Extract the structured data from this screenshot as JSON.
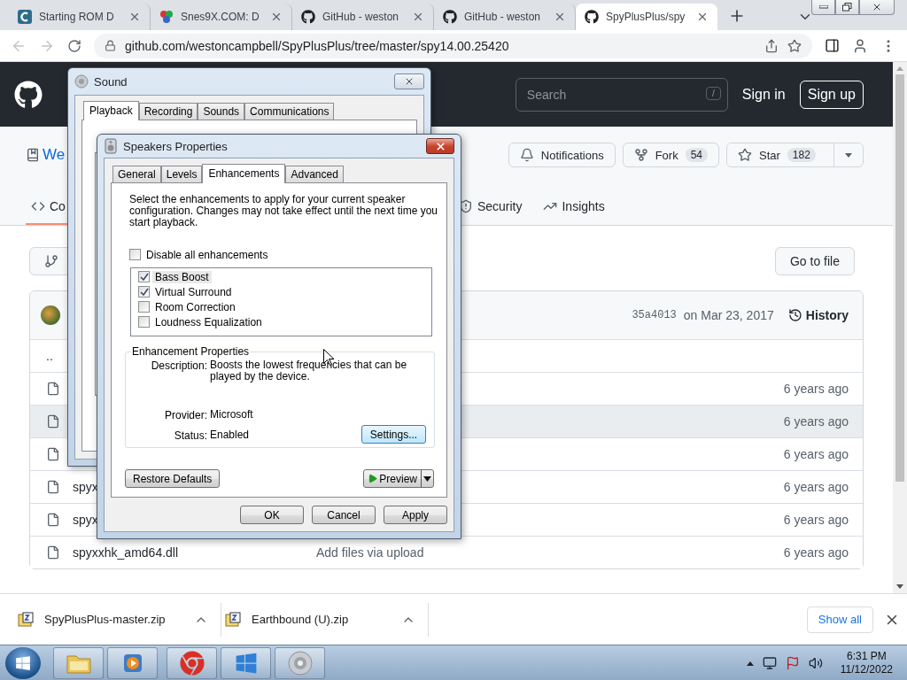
{
  "browser": {
    "tabs": [
      {
        "kind": "letter",
        "title": "Starting ROM D",
        "selected": false
      },
      {
        "kind": "balls",
        "title": "Snes9X.COM: D",
        "selected": false
      },
      {
        "kind": "octocat",
        "title": "GitHub - weston",
        "selected": false
      },
      {
        "kind": "octocat",
        "title": "GitHub - weston",
        "selected": false
      },
      {
        "kind": "octocat",
        "title": "SpyPlusPlus/spy",
        "selected": true
      }
    ],
    "address": "github.com/westoncampbell/SpyPlusPlus/tree/master/spy14.00.25420"
  },
  "github": {
    "search": {
      "placeholder": "Search",
      "shortcut": "/"
    },
    "sign_in": "Sign in",
    "sign_up": "Sign up",
    "repo_name": "We",
    "notifications": "Notifications",
    "fork": {
      "label": "Fork",
      "count": "54"
    },
    "star": {
      "label": "Star",
      "count": "182"
    },
    "repo_tabs": [
      {
        "kind": "code",
        "label": "Co",
        "selected": true
      },
      {
        "kind": "security",
        "label": "Security",
        "selected": false
      },
      {
        "kind": "insights",
        "label": "Insights",
        "selected": false
      }
    ],
    "go_to_file": "Go to file",
    "commit": {
      "hash": "35a4013",
      "date": "on Mar 23, 2017",
      "history": "History"
    },
    "files": [
      {
        "kind": "parent",
        "name": "..",
        "hovered": false
      },
      {
        "kind": "file",
        "age": "6 years ago",
        "hovered": false
      },
      {
        "kind": "file",
        "age": "6 years ago",
        "hovered": true
      },
      {
        "kind": "file",
        "age": "6 years ago",
        "hovered": false
      },
      {
        "kind": "file",
        "name": "spyx",
        "age": "6 years ago",
        "hovered": false
      },
      {
        "kind": "file",
        "name": "spyx",
        "age": "6 years ago",
        "hovered": false
      },
      {
        "kind": "file",
        "name": "spyxxhk_amd64.dll",
        "message": "Add files via upload",
        "age": "6 years ago",
        "hovered": false
      }
    ]
  },
  "downloads": {
    "items": [
      {
        "name": "SpyPlusPlus-master.zip"
      },
      {
        "name": "Earthbound (U).zip"
      }
    ],
    "show_all": "Show all"
  },
  "taskbar": {
    "apps": [
      {
        "kind": "folder"
      },
      {
        "kind": "media"
      },
      {
        "kind": "chrome"
      },
      {
        "kind": "windows"
      },
      {
        "kind": "speaker"
      }
    ],
    "time": "6:31 PM",
    "date": "11/12/2022"
  },
  "sound_dialog": {
    "title": "Sound",
    "tabs": [
      {
        "label": "Playback",
        "selected": true
      },
      {
        "label": "Recording",
        "selected": false
      },
      {
        "label": "Sounds",
        "selected": false
      },
      {
        "label": "Communications",
        "selected": false
      }
    ]
  },
  "speakers_dialog": {
    "title": "Speakers Properties",
    "tabs": [
      {
        "label": "General",
        "selected": false
      },
      {
        "label": "Levels",
        "selected": false
      },
      {
        "label": "Enhancements",
        "selected": true
      },
      {
        "label": "Advanced",
        "selected": false
      }
    ],
    "intro": "Select the enhancements to apply for your current speaker configuration. Changes may not take effect until the next time you start playback.",
    "disable_all": {
      "label": "Disable all enhancements",
      "checked": false
    },
    "enhancements": [
      {
        "label": "Bass Boost",
        "checked": true,
        "selected": true
      },
      {
        "label": "Virtual Surround",
        "checked": true,
        "selected": false
      },
      {
        "label": "Room Correction",
        "checked": false,
        "selected": false
      },
      {
        "label": "Loudness Equalization",
        "checked": false,
        "selected": false
      }
    ],
    "group_title": "Enhancement Properties",
    "properties": [
      {
        "label": "Description:",
        "value": "Boosts the lowest frequencies that can be played by the device."
      },
      {
        "label": "Provider:",
        "value": "Microsoft"
      },
      {
        "label": "Status:",
        "value": "Enabled"
      }
    ],
    "settings": "Settings...",
    "restore": "Restore Defaults",
    "preview": "Preview",
    "buttons": [
      "OK",
      "Cancel",
      "Apply"
    ]
  }
}
